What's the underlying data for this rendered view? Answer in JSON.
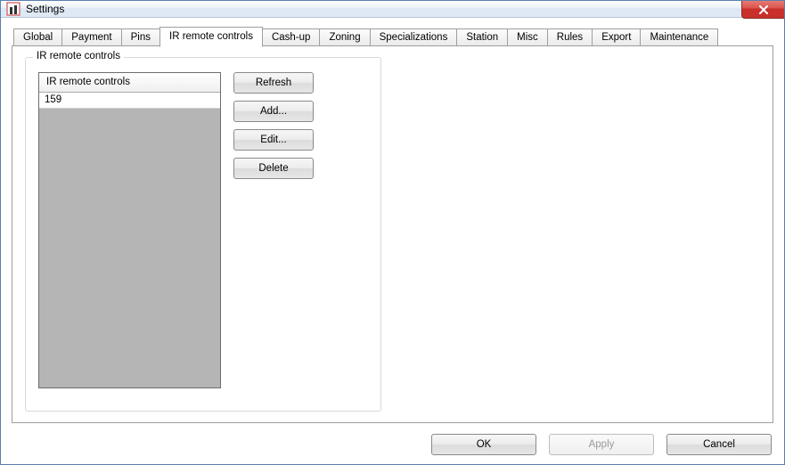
{
  "window": {
    "title": "Settings"
  },
  "tabs": [
    {
      "label": "Global"
    },
    {
      "label": "Payment"
    },
    {
      "label": "Pins"
    },
    {
      "label": "IR remote controls"
    },
    {
      "label": "Cash-up"
    },
    {
      "label": "Zoning"
    },
    {
      "label": "Specializations"
    },
    {
      "label": "Station"
    },
    {
      "label": "Misc"
    },
    {
      "label": "Rules"
    },
    {
      "label": "Export"
    },
    {
      "label": "Maintenance"
    }
  ],
  "active_tab_index": 3,
  "groupbox": {
    "title": "IR remote controls",
    "grid_header": "IR remote controls",
    "rows": [
      {
        "value": "159"
      }
    ]
  },
  "buttons": {
    "refresh": "Refresh",
    "add": "Add...",
    "edit": "Edit...",
    "delete": "Delete"
  },
  "footer": {
    "ok": "OK",
    "apply": "Apply",
    "cancel": "Cancel"
  }
}
